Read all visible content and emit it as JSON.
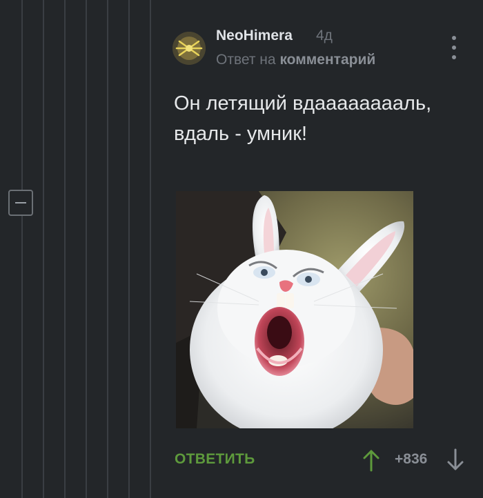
{
  "comment": {
    "author": "NeoHimera",
    "time_ago": "4д",
    "reply_prefix": "Ответ на",
    "reply_link": "комментарий",
    "text": "Он летящий вдааааааааль, вдаль - умник!"
  },
  "actions": {
    "reply_label": "ОТВЕТИТЬ",
    "rating": "+836"
  },
  "colors": {
    "background": "#232629",
    "reply_green": "#5e9a3c",
    "muted": "#6e737a"
  },
  "icons": {
    "more": "more-vertical-icon",
    "upvote": "arrow-up-icon",
    "downvote": "arrow-down-icon",
    "collapse": "minus-icon"
  }
}
